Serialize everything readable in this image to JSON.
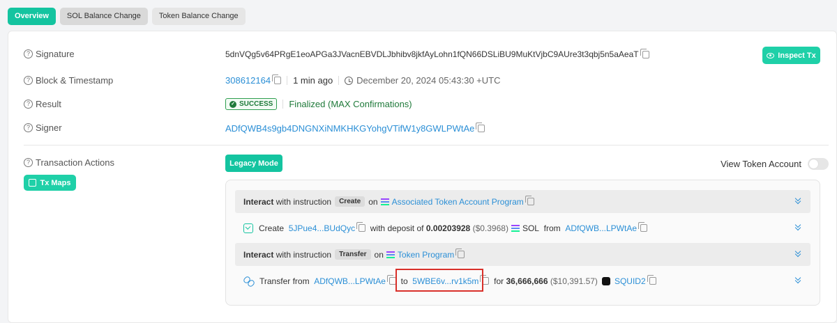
{
  "tabs": [
    "Overview",
    "SOL Balance Change",
    "Token Balance Change"
  ],
  "signature": {
    "label": "Signature",
    "value": "5dnVQg5v64PRgE1eoAPGa3JVacnEBVDLJbhibv8jkfAyLohn1fQN66DSLiBU9MuKtVjbC9AUre3t3qbj5n5aAeaT"
  },
  "inspect_label": "Inspect Tx",
  "block": {
    "label": "Block & Timestamp",
    "number": "308612164",
    "ago": "1 min ago",
    "timestamp": "December 20, 2024 05:43:30 +UTC"
  },
  "result": {
    "label": "Result",
    "status": "SUCCESS",
    "finality": "Finalized (MAX Confirmations)"
  },
  "signer": {
    "label": "Signer",
    "value": "ADfQWB4s9gb4DNGNXiNMKHKGYohgVTifW1y8GWLPWtAe"
  },
  "actions": {
    "label": "Transaction Actions",
    "tx_maps": "Tx Maps",
    "legacy_mode": "Legacy Mode",
    "view_token_account": "View Token Account",
    "rows": [
      {
        "interact": "Interact",
        "with_instruction": "with instruction",
        "instruction": "Create",
        "on": "on",
        "program": "Associated Token Account Program"
      },
      {
        "verb": "Create",
        "account": "5JPue4...BUdQyc",
        "with_deposit": "with deposit of",
        "amount": "0.00203928",
        "usd": "($0.3968)",
        "token": "SOL",
        "from": "from",
        "from_account": "ADfQWB...LPWtAe"
      },
      {
        "interact": "Interact",
        "with_instruction": "with instruction",
        "instruction": "Transfer",
        "on": "on",
        "program": "Token Program"
      },
      {
        "verb": "Transfer from",
        "from_account": "ADfQWB...LPWtAe",
        "to": "to",
        "to_account": "5WBE6v...rv1k5m",
        "for": "for",
        "amount": "36,666,666",
        "usd": "($10,391.57)",
        "token": "SQUID2"
      }
    ]
  },
  "colors": {
    "accent": "#14c4a0",
    "link": "#2b8fd6",
    "success": "#1f7a3a",
    "highlight": "#d9302a"
  }
}
